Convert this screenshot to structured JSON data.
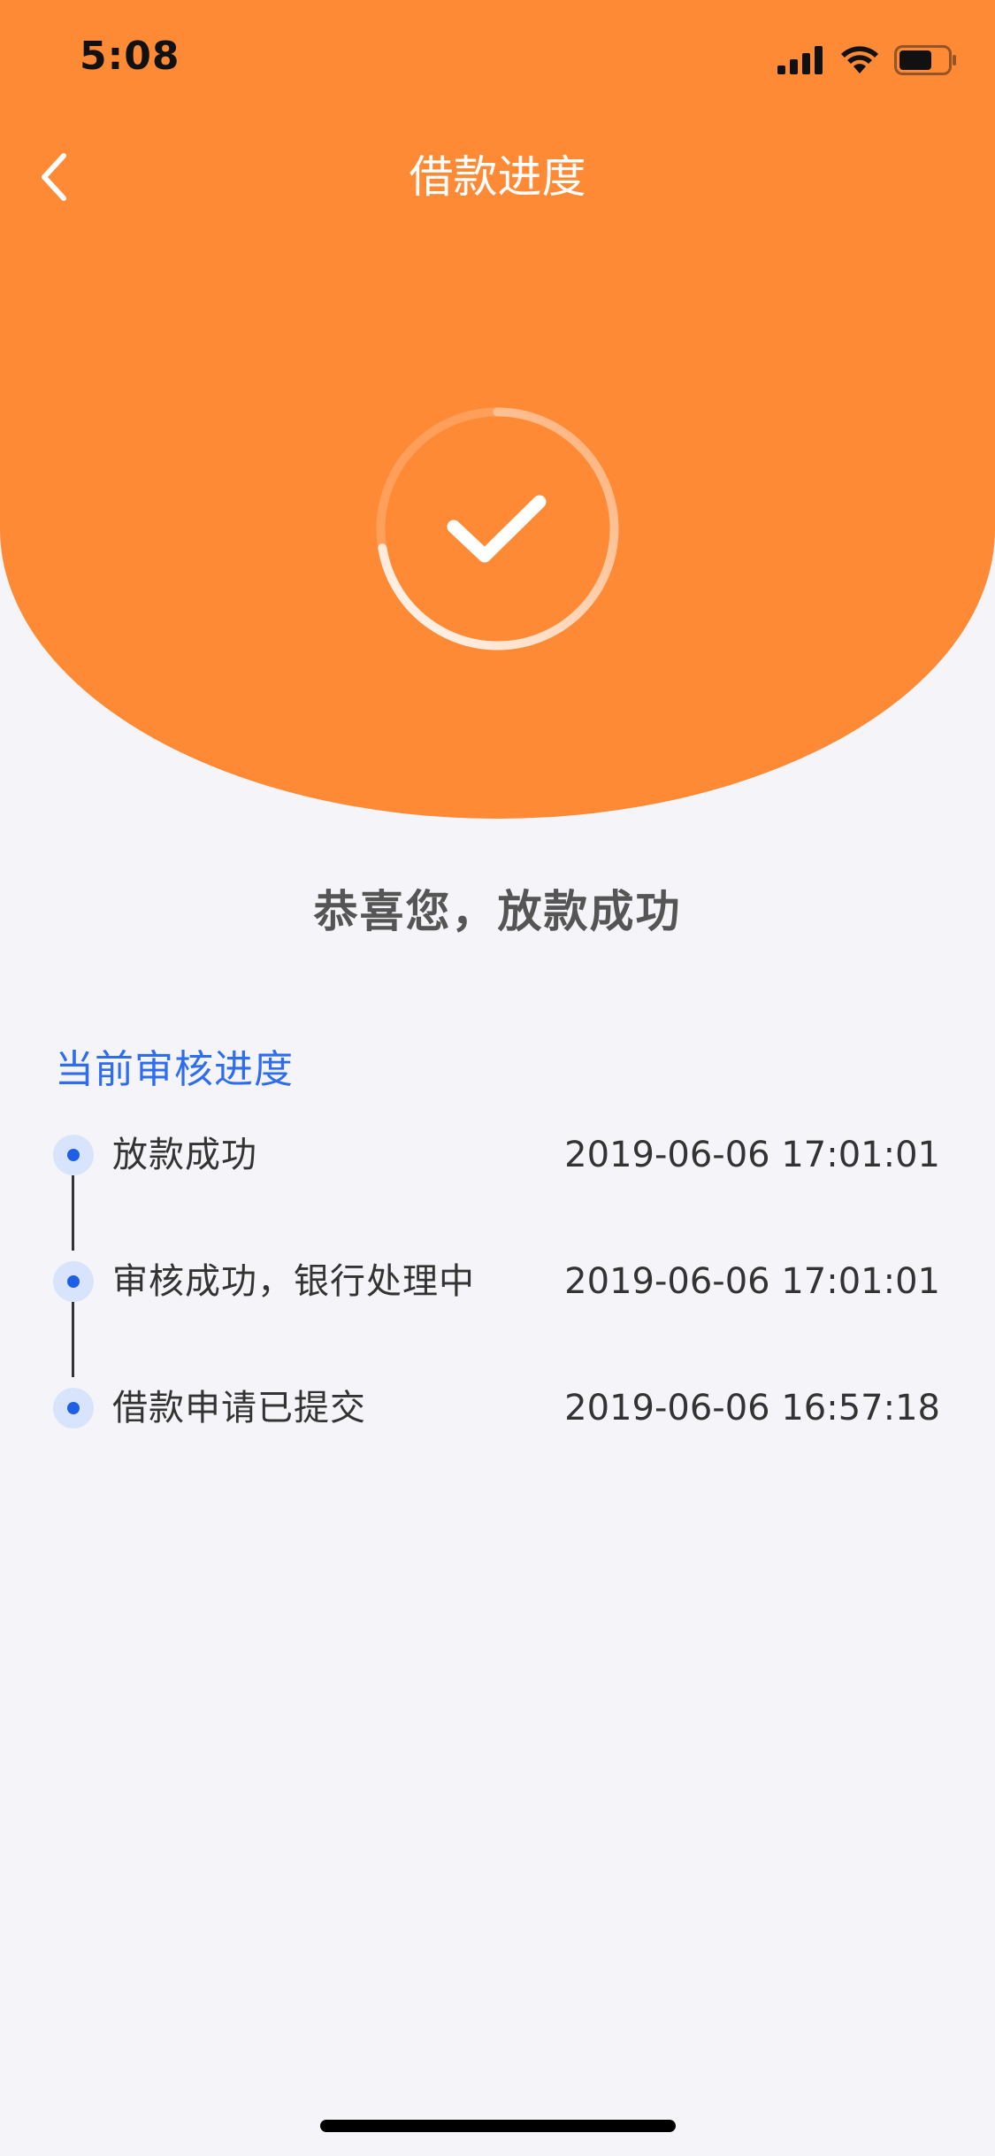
{
  "status_bar": {
    "time": "5:08"
  },
  "nav": {
    "title": "借款进度"
  },
  "result": {
    "message": "恭喜您，放款成功"
  },
  "progress": {
    "section_title": "当前审核进度",
    "steps": [
      {
        "label": "放款成功",
        "time": "2019-06-06 17:01:01"
      },
      {
        "label": "审核成功，银行处理中",
        "time": "2019-06-06 17:01:01"
      },
      {
        "label": "借款申请已提交",
        "time": "2019-06-06 16:57:18"
      }
    ]
  },
  "colors": {
    "header_bg": "#ff8a35",
    "accent_blue": "#2e6cf0",
    "page_bg": "#f5f5f9"
  }
}
